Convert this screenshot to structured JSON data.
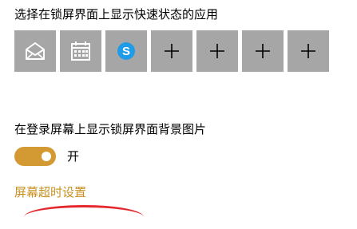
{
  "quick_status": {
    "heading": "选择在锁屏界面上显示快速状态的应用",
    "tiles": [
      {
        "icon": "mail-icon",
        "label": ""
      },
      {
        "icon": "calendar-icon",
        "label": ""
      },
      {
        "icon": "skype-icon",
        "label": ""
      },
      {
        "icon": "plus-icon",
        "label": "+"
      },
      {
        "icon": "plus-icon",
        "label": "+"
      },
      {
        "icon": "plus-icon",
        "label": "+"
      },
      {
        "icon": "plus-icon",
        "label": "+"
      }
    ]
  },
  "background_setting": {
    "heading": "在登录屏幕上显示锁屏界面背景图片",
    "toggle_state": "开",
    "toggle_on": true
  },
  "timeout_link": "屏幕超时设置",
  "colors": {
    "tile_bg": "#a6a6a6",
    "accent": "#d39a34",
    "link": "#c8901f",
    "annotation": "#e5282d",
    "skype": "#1f9be8"
  }
}
